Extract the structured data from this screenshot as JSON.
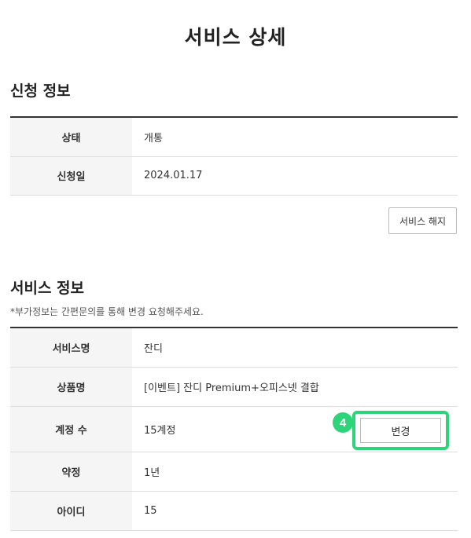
{
  "page": {
    "title": "서비스 상세"
  },
  "application_info": {
    "title": "신청 정보",
    "rows": [
      {
        "label": "상태",
        "value": "개통"
      },
      {
        "label": "신청일",
        "value": "2024.01.17"
      }
    ],
    "cancel_button": "서비스 해지"
  },
  "service_info": {
    "title": "서비스 정보",
    "note": "*부가정보는 간편문의를 통해 변경 요청해주세요.",
    "rows": [
      {
        "label": "서비스명",
        "value": "잔디"
      },
      {
        "label": "상품명",
        "value": "[이벤트] 잔디 Premium+오피스넷 결합"
      },
      {
        "label": "계정 수",
        "value": "15계정"
      },
      {
        "label": "약정",
        "value": "1년"
      },
      {
        "label": "아이디",
        "value": "15"
      }
    ],
    "change_button": "변경",
    "step_badge": "4",
    "highlight_color": "#2ed47a"
  }
}
